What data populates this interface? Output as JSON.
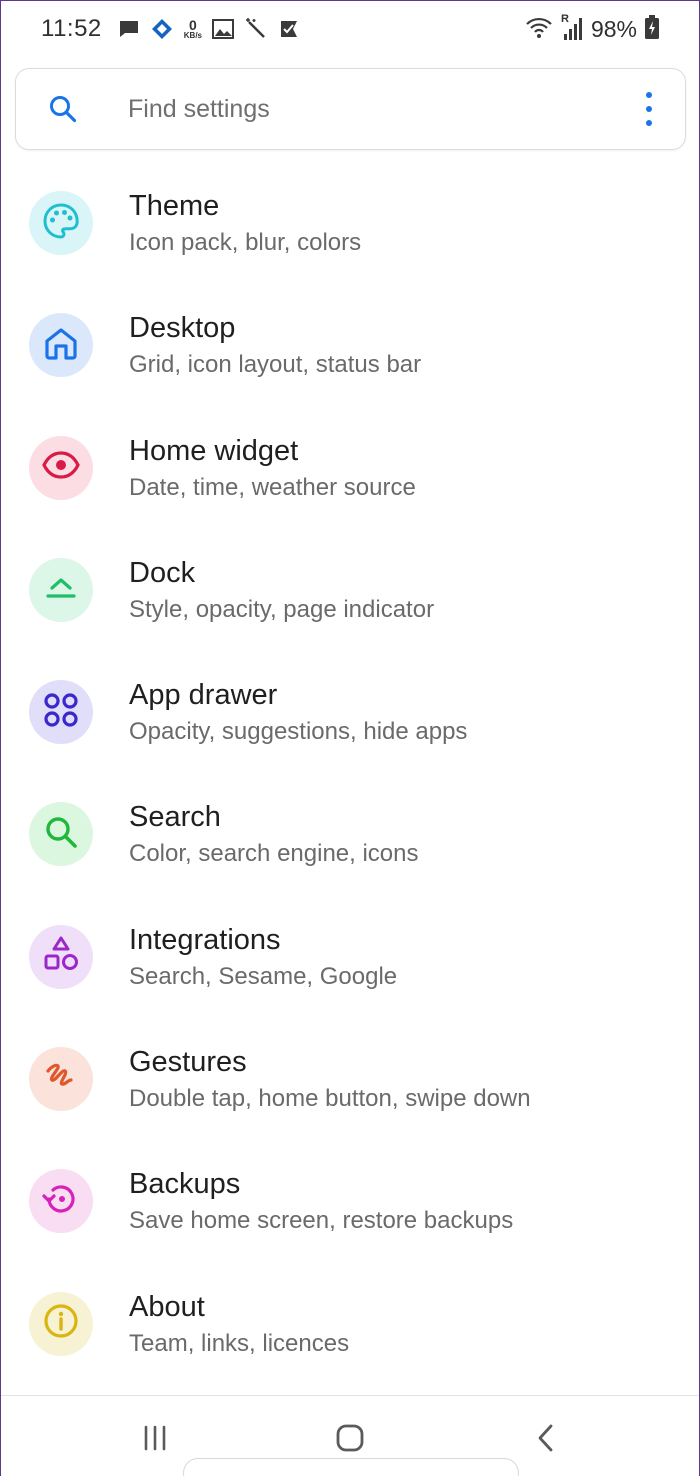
{
  "status_bar": {
    "time": "11:52",
    "speed_value": "0",
    "speed_unit": "KB/s",
    "network_label": "R",
    "battery": "98%"
  },
  "search": {
    "placeholder": "Find settings"
  },
  "colors": {
    "accent": "#1a73e8"
  },
  "settings": [
    {
      "title": "Theme",
      "subtitle": "Icon pack, blur, colors",
      "icon": "palette-icon",
      "color": "#1fbfd0",
      "bg": "#d9f5f8"
    },
    {
      "title": "Desktop",
      "subtitle": "Grid, icon layout, status bar",
      "icon": "home-icon",
      "color": "#1a73e8",
      "bg": "#dbe8fb"
    },
    {
      "title": "Home widget",
      "subtitle": "Date, time, weather source",
      "icon": "eye-icon",
      "color": "#d81b47",
      "bg": "#fbdde3"
    },
    {
      "title": "Dock",
      "subtitle": "Style, opacity, page indicator",
      "icon": "dock-icon",
      "color": "#1fbf6a",
      "bg": "#dcf6e8"
    },
    {
      "title": "App drawer",
      "subtitle": "Opacity, suggestions, hide apps",
      "icon": "apps-grid-icon",
      "color": "#3b28cc",
      "bg": "#e1defa"
    },
    {
      "title": "Search",
      "subtitle": "Color, search engine, icons",
      "icon": "search-icon",
      "color": "#20b83a",
      "bg": "#dcf7e0"
    },
    {
      "title": "Integrations",
      "subtitle": "Search, Sesame, Google",
      "icon": "shapes-icon",
      "color": "#9c27c9",
      "bg": "#efdff8"
    },
    {
      "title": "Gestures",
      "subtitle": "Double tap, home button, swipe down",
      "icon": "gesture-icon",
      "color": "#e0572a",
      "bg": "#fbe2da"
    },
    {
      "title": "Backups",
      "subtitle": "Save home screen, restore backups",
      "icon": "restore-icon",
      "color": "#d622b8",
      "bg": "#f9ddf3"
    },
    {
      "title": "About",
      "subtitle": "Team, links, licences",
      "icon": "info-icon",
      "color": "#d8b50f",
      "bg": "#f8f2d4"
    }
  ]
}
